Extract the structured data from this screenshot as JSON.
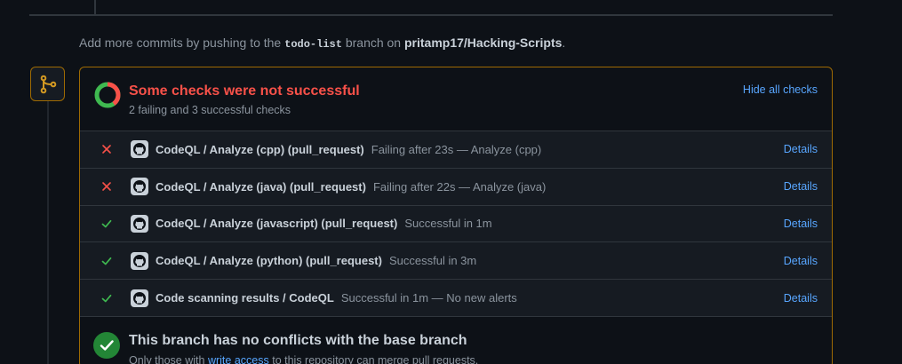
{
  "hint": {
    "prefix": "Add more commits by pushing to the",
    "branch": "todo-list",
    "middle": "branch on",
    "repo": "pritamp17/Hacking-Scripts",
    "suffix": "."
  },
  "checks_summary": {
    "title": "Some checks were not successful",
    "subtitle": "2 failing and 3 successful checks",
    "hide_label": "Hide all checks",
    "failure_ratio": 0.4
  },
  "checks": [
    {
      "status": "failure",
      "name": "CodeQL / Analyze (cpp) (pull_request)",
      "desc": "Failing after 23s — Analyze (cpp)",
      "details_label": "Details"
    },
    {
      "status": "failure",
      "name": "CodeQL / Analyze (java) (pull_request)",
      "desc": "Failing after 22s — Analyze (java)",
      "details_label": "Details"
    },
    {
      "status": "success",
      "name": "CodeQL / Analyze (javascript) (pull_request)",
      "desc": "Successful in 1m",
      "details_label": "Details"
    },
    {
      "status": "success",
      "name": "CodeQL / Analyze (python) (pull_request)",
      "desc": "Successful in 3m",
      "details_label": "Details"
    },
    {
      "status": "success",
      "name": "Code scanning results / CodeQL",
      "desc": "Successful in 1m — No new alerts",
      "details_label": "Details"
    }
  ],
  "merge_state": {
    "title": "This branch has no conflicts with the base branch",
    "sub_prefix": "Only those with",
    "sub_link": "write access",
    "sub_suffix": "to this repository can merge pull requests."
  },
  "colors": {
    "failure": "#f85149",
    "success": "#3fb950",
    "link": "#58a6ff",
    "warning_border": "#9e6a03"
  }
}
